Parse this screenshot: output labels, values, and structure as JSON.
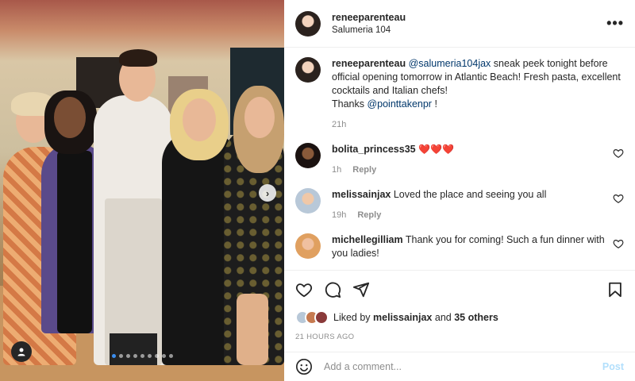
{
  "post": {
    "username": "reneeparenteau",
    "location": "Salumeria 104",
    "more_label": "•••"
  },
  "caption": {
    "username": "reneeparenteau",
    "mention1": "@salumeria104jax",
    "text1": " sneak peek tonight before official opening tomorrow in Atlantic Beach! Fresh pasta, excellent cocktails and Italian chefs!",
    "thanks": "Thanks ",
    "mention2": "@pointtakenpr",
    "text2": " !",
    "time": "21h"
  },
  "comments": [
    {
      "username": "bolita_princess35",
      "text": "❤️❤️❤️",
      "time": "1h",
      "reply": "Reply"
    },
    {
      "username": "melissainjax",
      "text": "Loved the place and seeing you all",
      "time": "19h",
      "reply": "Reply"
    },
    {
      "username": "michellegilliam",
      "text": "Thank you for coming! Such a fun dinner with you ladies!"
    }
  ],
  "likes": {
    "prefix": "Liked by ",
    "user": "melissainjax",
    "and": " and ",
    "others": "35 others"
  },
  "timestamp": "21 HOURS AGO",
  "add_comment": {
    "placeholder": "Add a comment...",
    "post_label": "Post"
  },
  "carousel": {
    "total_slides": 9,
    "active_index": 0,
    "next_symbol": "›"
  },
  "colors": {
    "link": "#00376b",
    "muted": "#8e8e8e",
    "post_disabled": "#b2dffc",
    "active_dot": "#3b8ef0"
  },
  "icons": [
    "heart-icon",
    "comment-icon",
    "share-icon",
    "bookmark-icon",
    "emoji-icon",
    "more-icon",
    "user-tag-icon",
    "chevron-right-icon"
  ]
}
